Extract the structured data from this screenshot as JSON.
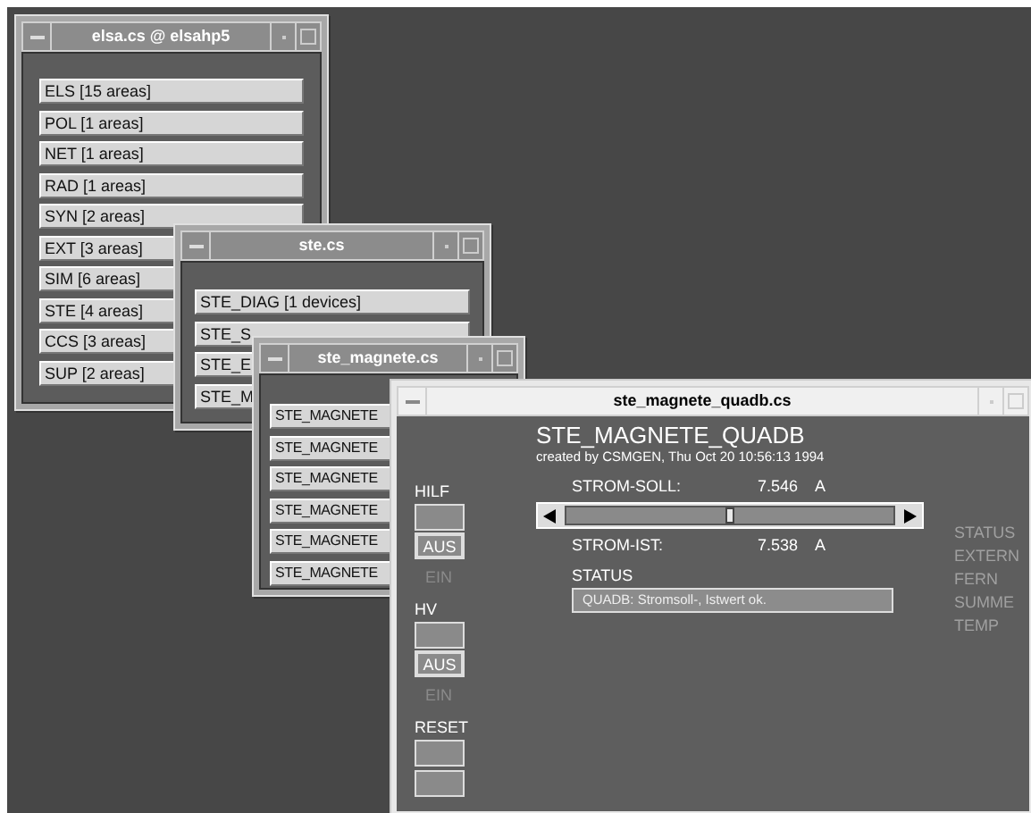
{
  "windows": [
    {
      "title": "elsa.cs @ elsahp5",
      "active": false,
      "items": [
        "ELS [15 areas]",
        "POL [1 areas]",
        "NET [1 areas]",
        "RAD [1 areas]",
        "SYN [2 areas]",
        "EXT [3 areas]",
        "SIM [6 areas]",
        "STE [4 areas]",
        "CCS [3 areas]",
        "SUP [2 areas]"
      ]
    },
    {
      "title": "ste.cs",
      "active": false,
      "items": [
        "STE_DIAG [1 devices]",
        "STE_S",
        "STE_E",
        "STE_M"
      ]
    },
    {
      "title": "ste_magnete.cs",
      "active": false,
      "items": [
        "STE_MAGNETE",
        "STE_MAGNETE",
        "STE_MAGNETE",
        "STE_MAGNETE",
        "STE_MAGNETE",
        "STE_MAGNETE"
      ]
    }
  ],
  "panel": {
    "title": "ste_magnete_quadb.cs",
    "active": true,
    "heading": "STE_MAGNETE_QUADB",
    "subtitle": "created by CSMGEN, Thu Oct 20 10:56:13 1994",
    "groups": [
      {
        "label": "HILF",
        "off": "AUS",
        "on": "EIN"
      },
      {
        "label": "HV",
        "off": "AUS",
        "on": "EIN"
      }
    ],
    "reset": {
      "label": "RESET"
    },
    "soll": {
      "label": "STROM-SOLL:",
      "value": "7.546",
      "unit": "A"
    },
    "slider": {
      "level": 0.5
    },
    "ist": {
      "label": "STROM-IST:",
      "value": "7.538",
      "unit": "A"
    },
    "status": {
      "label": "STATUS",
      "value": "QUADB: Stromsoll-, Istwert ok."
    },
    "indicators": [
      "STATUS",
      "EXTERN",
      "FERN",
      "SUMME",
      "TEMP"
    ]
  }
}
